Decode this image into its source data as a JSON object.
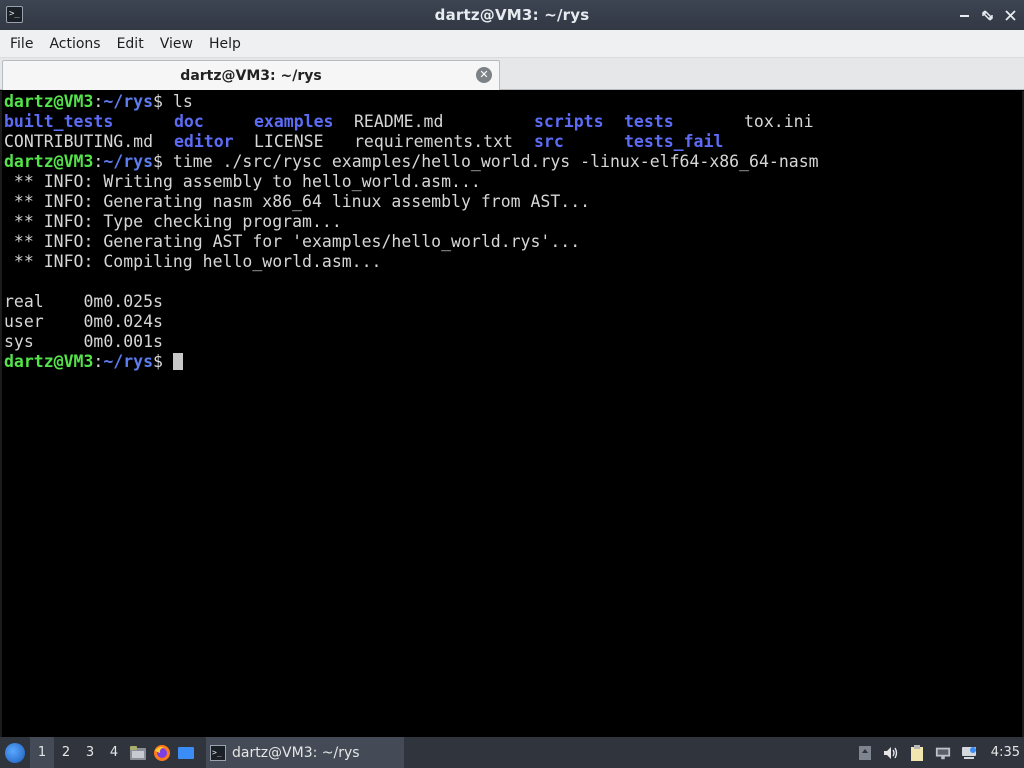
{
  "window": {
    "title": "dartz@VM3: ~/rys",
    "icon": "terminal-icon",
    "colors": {
      "titlebar": "#323844",
      "accent": "#54e34a",
      "dir": "#5d6cf6"
    }
  },
  "menubar": {
    "items": [
      "File",
      "Actions",
      "Edit",
      "View",
      "Help"
    ]
  },
  "tab": {
    "label": "dartz@VM3: ~/rys"
  },
  "terminal": {
    "prompt": {
      "user": "dartz@VM3",
      "sep": ":",
      "path": "~/rys",
      "symbol": "$ "
    },
    "cmd1": "ls",
    "ls": {
      "row1": {
        "c1": "built_tests",
        "c2": "doc",
        "c3": "examples",
        "c4": "README.md",
        "c5": "scripts",
        "c6": "tests",
        "c7": "tox.ini"
      },
      "row2": {
        "c1": "CONTRIBUTING.md",
        "c2": "editor",
        "c3": "LICENSE",
        "c4": "requirements.txt",
        "c5": "src",
        "c6": "tests_fail"
      }
    },
    "cmd2": "time ./src/rysc examples/hello_world.rys -linux-elf64-x86_64-nasm",
    "info": [
      " ** INFO: Writing assembly to hello_world.asm...",
      " ** INFO: Generating nasm x86_64 linux assembly from AST...",
      " ** INFO: Type checking program...",
      " ** INFO: Generating AST for 'examples/hello_world.rys'...",
      " ** INFO: Compiling hello_world.asm..."
    ],
    "timing": [
      "real    0m0.025s",
      "user    0m0.024s",
      "sys     0m0.001s"
    ]
  },
  "taskbar": {
    "workspaces": [
      "1",
      "2",
      "3",
      "4"
    ],
    "active_workspace": "1",
    "launchers": [
      "file-manager-icon",
      "firefox-icon",
      "desktop-icon"
    ],
    "task_label": "dartz@VM3: ~/rys",
    "tray": [
      "update-icon",
      "volume-icon",
      "clipboard-icon",
      "network-icon",
      "notification-icon"
    ],
    "clock": "4:35"
  }
}
